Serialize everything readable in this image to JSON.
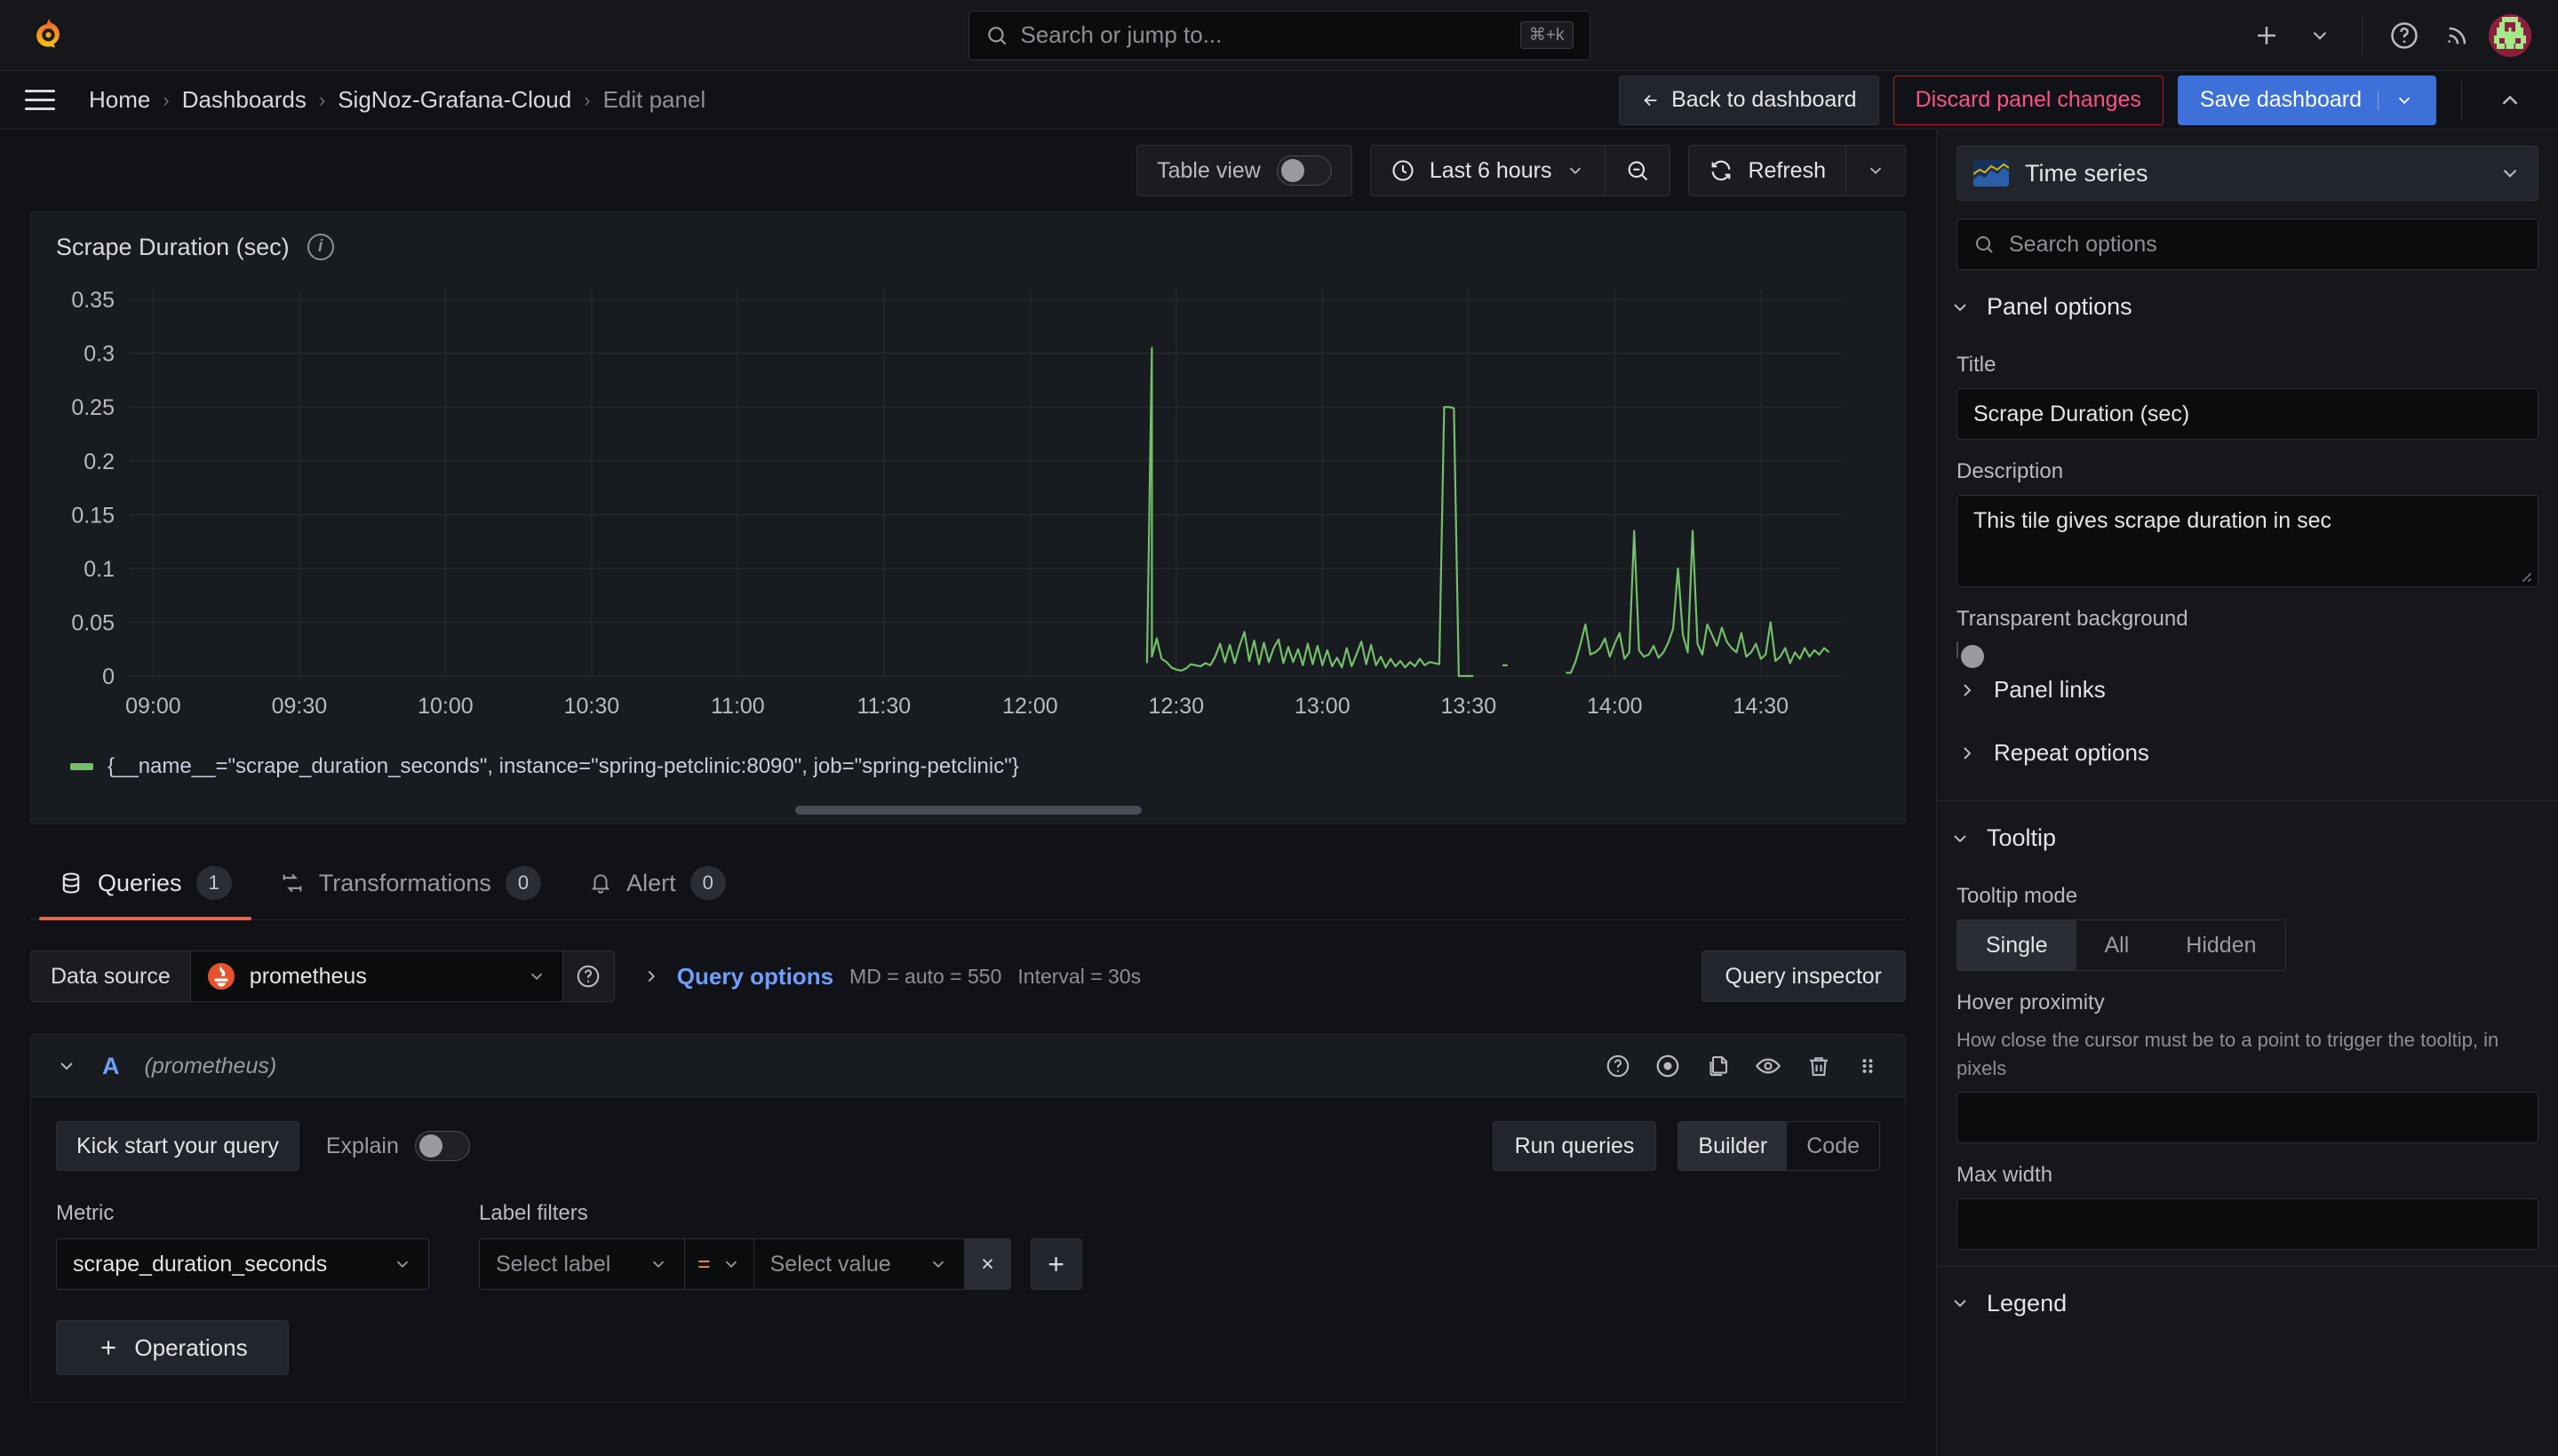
{
  "topnav": {
    "search_placeholder": "Search or jump to...",
    "search_kbd": "⌘+k",
    "icons": {
      "logo": "grafana-logo",
      "search": "search-icon",
      "plus": "plus-icon",
      "plus_chevron": "chevron-down-icon",
      "help": "help-circle-icon",
      "news": "rss-icon",
      "avatar": "user-avatar"
    }
  },
  "breadcrumb": {
    "items": [
      {
        "label": "Home",
        "current": false
      },
      {
        "label": "Dashboards",
        "current": false
      },
      {
        "label": "SigNoz-Grafana-Cloud",
        "current": false
      },
      {
        "label": "Edit panel",
        "current": true
      }
    ],
    "separator": "›",
    "back_to_dashboard": "Back to dashboard",
    "discard_panel_changes": "Discard panel changes",
    "save_dashboard": "Save dashboard"
  },
  "viz_toolbar": {
    "table_view_label": "Table view",
    "table_view_on": false,
    "time_range": "Last 6 hours",
    "refresh_label": "Refresh"
  },
  "panel": {
    "title": "Scrape Duration (sec)",
    "legend": "{__name__=\"scrape_duration_seconds\", instance=\"spring-petclinic:8090\", job=\"spring-petclinic\"}",
    "series_color": "#73bf69"
  },
  "chart_data": {
    "type": "line",
    "title": "Scrape Duration (sec)",
    "xlabel": "",
    "ylabel": "",
    "ylim": [
      0,
      0.36
    ],
    "yticks": [
      0,
      0.05,
      0.1,
      0.15,
      0.2,
      0.25,
      0.3,
      0.35
    ],
    "ytick_labels": [
      "0",
      "0.05",
      "0.1",
      "0.15",
      "0.2",
      "0.25",
      "0.3",
      "0.35"
    ],
    "xticks": [
      "09:00",
      "09:30",
      "10:00",
      "10:30",
      "11:00",
      "11:30",
      "12:00",
      "12:30",
      "13:00",
      "13:30",
      "14:00",
      "14:30"
    ],
    "xlim": [
      "08:55",
      "14:47"
    ],
    "grid": true,
    "legend_position": "bottom",
    "series": [
      {
        "name": "{__name__=\"scrape_duration_seconds\", instance=\"spring-petclinic:8090\", job=\"spring-petclinic\"}",
        "color": "#73bf69",
        "x": [
          "12:24",
          "12:25",
          "12:25",
          "12:26",
          "12:27",
          "12:28",
          "12:29",
          "12:30",
          "12:31",
          "12:32",
          "12:33",
          "12:34",
          "12:35",
          "12:36",
          "12:37",
          "12:38",
          "12:39",
          "12:40",
          "12:41",
          "12:42",
          "12:43",
          "12:44",
          "12:45",
          "12:46",
          "12:47",
          "12:48",
          "12:49",
          "12:50",
          "12:51",
          "12:52",
          "12:53",
          "12:54",
          "12:55",
          "12:56",
          "12:57",
          "12:58",
          "12:59",
          "13:00",
          "13:01",
          "13:02",
          "13:03",
          "13:04",
          "13:05",
          "13:06",
          "13:07",
          "13:08",
          "13:09",
          "13:10",
          "13:11",
          "13:12",
          "13:13",
          "13:14",
          "13:15",
          "13:16",
          "13:17",
          "13:18",
          "13:19",
          "13:20",
          "13:21",
          "13:22",
          "13:23",
          "13:24",
          "13:25",
          "13:26",
          "13:27",
          "13:28",
          "13:29",
          "13:30",
          "13:31",
          "13:37",
          "13:38",
          "13:50",
          "13:51",
          "13:52",
          "13:53",
          "13:54",
          "13:55",
          "13:56",
          "13:57",
          "13:58",
          "13:59",
          "14:00",
          "14:01",
          "14:02",
          "14:03",
          "14:04",
          "14:05",
          "14:06",
          "14:07",
          "14:08",
          "14:09",
          "14:10",
          "14:11",
          "14:12",
          "14:13",
          "14:14",
          "14:15",
          "14:16",
          "14:17",
          "14:18",
          "14:19",
          "14:20",
          "14:21",
          "14:22",
          "14:23",
          "14:24",
          "14:25",
          "14:26",
          "14:27",
          "14:28",
          "14:29",
          "14:30",
          "14:31",
          "14:32",
          "14:33",
          "14:34",
          "14:35",
          "14:36",
          "14:37",
          "14:38",
          "14:39",
          "14:40",
          "14:41",
          "14:42",
          "14:43",
          "14:44",
          "14:45"
        ],
        "y": [
          0.012,
          0.305,
          0.018,
          0.035,
          0.016,
          0.013,
          0.008,
          0.006,
          0.005,
          0.007,
          0.011,
          0.01,
          0.009,
          0.012,
          0.01,
          0.018,
          0.03,
          0.013,
          0.029,
          0.012,
          0.028,
          0.041,
          0.014,
          0.033,
          0.011,
          0.031,
          0.013,
          0.026,
          0.034,
          0.012,
          0.027,
          0.013,
          0.025,
          0.01,
          0.03,
          0.011,
          0.028,
          0.01,
          0.024,
          0.009,
          0.017,
          0.008,
          0.026,
          0.009,
          0.02,
          0.032,
          0.011,
          0.029,
          0.01,
          0.018,
          0.008,
          0.016,
          0.009,
          0.014,
          0.008,
          0.013,
          0.009,
          0.016,
          0.01,
          0.013,
          0.012,
          0.011,
          0.25,
          0.25,
          0.249,
          0.0,
          0.0,
          0.0,
          0.0,
          0.01,
          0.01,
          0.003,
          0.003,
          0.014,
          0.03,
          0.048,
          0.02,
          0.022,
          0.026,
          0.035,
          0.018,
          0.03,
          0.04,
          0.016,
          0.022,
          0.135,
          0.024,
          0.018,
          0.02,
          0.028,
          0.017,
          0.022,
          0.031,
          0.044,
          0.1,
          0.038,
          0.022,
          0.135,
          0.03,
          0.02,
          0.048,
          0.038,
          0.028,
          0.045,
          0.032,
          0.026,
          0.022,
          0.04,
          0.018,
          0.022,
          0.03,
          0.016,
          0.02,
          0.05,
          0.014,
          0.018,
          0.026,
          0.012,
          0.022,
          0.016,
          0.026,
          0.018,
          0.024,
          0.02,
          0.026,
          0.022
        ]
      }
    ]
  },
  "tabs": [
    {
      "label": "Queries",
      "count": "1",
      "active": true,
      "icon": "database-icon"
    },
    {
      "label": "Transformations",
      "count": "0",
      "active": false,
      "icon": "transform-icon"
    },
    {
      "label": "Alert",
      "count": "0",
      "active": false,
      "icon": "bell-icon"
    }
  ],
  "queries": {
    "data_source_label": "Data source",
    "data_source_value": "prometheus",
    "query_options_label": "Query options",
    "query_options_md": "MD = auto = 550",
    "query_options_interval": "Interval = 30s",
    "query_inspector": "Query inspector",
    "row": {
      "ref_id": "A",
      "data_source": "(prometheus)",
      "kick_start": "Kick start your query",
      "explain_label": "Explain",
      "explain_on": false,
      "run_queries": "Run queries",
      "mode_builder": "Builder",
      "mode_code": "Code",
      "mode_active": "Builder",
      "metric_label": "Metric",
      "metric_value": "scrape_duration_seconds",
      "label_filters_label": "Label filters",
      "filter_label_placeholder": "Select label",
      "filter_operator": "=",
      "filter_value_placeholder": "Select value",
      "remove_filter": "×",
      "add_filter": "+",
      "operations": "Operations"
    }
  },
  "options_pane": {
    "viz_type": "Time series",
    "search_placeholder": "Search options",
    "panel_options": {
      "section_title": "Panel options",
      "title_label": "Title",
      "title_value": "Scrape Duration (sec)",
      "description_label": "Description",
      "description_value": "This tile gives scrape duration in sec",
      "transparent_label": "Transparent background",
      "transparent_on": false,
      "panel_links": "Panel links",
      "repeat_options": "Repeat options"
    },
    "tooltip": {
      "section_title": "Tooltip",
      "mode_label": "Tooltip mode",
      "modes": [
        "Single",
        "All",
        "Hidden"
      ],
      "mode_active": "Single",
      "hover_label": "Hover proximity",
      "hover_help": "How close the cursor must be to a point to trigger the tooltip, in pixels",
      "hover_value": "",
      "max_width_label": "Max width",
      "max_width_value": ""
    },
    "legend": {
      "section_title": "Legend"
    }
  },
  "colors": {
    "accent_blue": "#3d71d9",
    "accent_orange": "#f55f3e",
    "danger": "#ff5286",
    "series_green": "#73bf69",
    "link_blue": "#6e9fff",
    "operator_orange": "#ff9830"
  }
}
